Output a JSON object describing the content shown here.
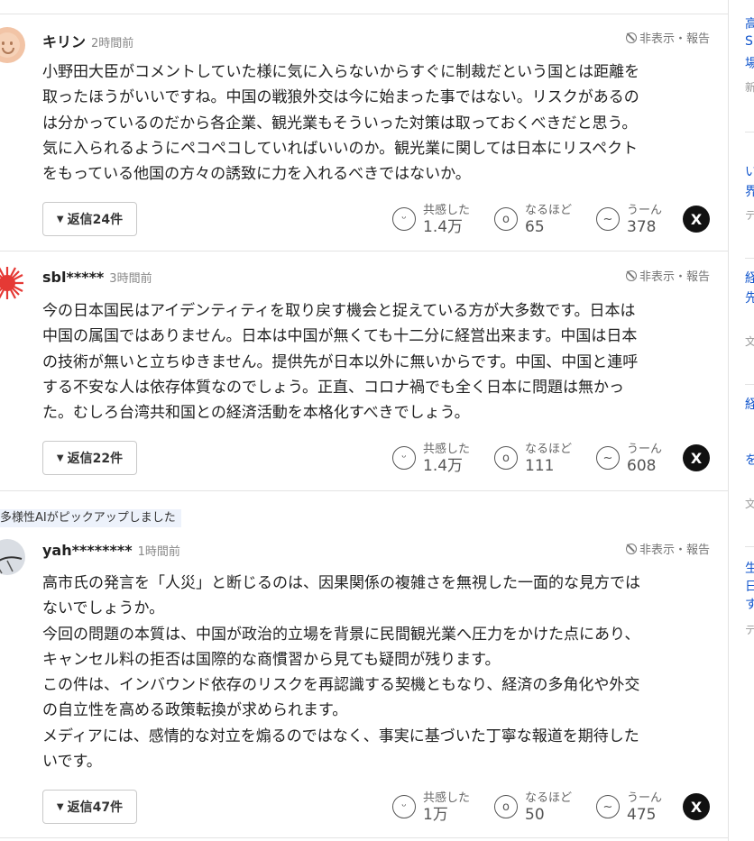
{
  "comments": [
    {
      "user": "キリン",
      "time": "2時間前",
      "hide_report": "非表示・報告",
      "lines": [
        "小野田大臣がコメントしていた様に気に入らないからすぐに制裁だという国とは距離を",
        "取ったほうがいいですね。中国の戦狼外交は今に始まった事ではない。リスクがあるの",
        "は分かっているのだから各企業、観光業もそういった対策は取っておくべきだと思う。",
        "気に入られるようにペコペコしていればいいのか。観光業に関しては日本にリスペクト",
        "をもっている他国の方々の誘致に力を入れるべきではないか。"
      ],
      "reply_label": "返信24件",
      "reactions": [
        {
          "label": "共感した",
          "count": "1.4万"
        },
        {
          "label": "なるほど",
          "count": "65"
        },
        {
          "label": "うーん",
          "count": "378"
        }
      ]
    },
    {
      "user": "sbl*****",
      "time": "3時間前",
      "hide_report": "非表示・報告",
      "lines": [
        "今の日本国民はアイデンティティを取り戻す機会と捉えている方が大多数です。日本は",
        "中国の属国ではありません。日本は中国が無くても十二分に経営出来ます。中国は日本",
        "の技術が無いと立ちゆきません。提供先が日本以外に無いからです。中国、中国と連呼",
        "する不安な人は依存体質なのでしょう。正直、コロナ禍でも全く日本に問題は無かっ",
        "た。むしろ台湾共和国との経済活動を本格化すべきでしょう。"
      ],
      "reply_label": "返信22件",
      "reactions": [
        {
          "label": "共感した",
          "count": "1.4万"
        },
        {
          "label": "なるほど",
          "count": "111"
        },
        {
          "label": "うーん",
          "count": "608"
        }
      ]
    },
    {
      "ai_tag": "多様性AIがピックアップしました",
      "user": "yah********",
      "time": "1時間前",
      "hide_report": "非表示・報告",
      "lines": [
        "高市氏の発言を「人災」と断じるのは、因果関係の複雑さを無視した一面的な見方では",
        "ないでしょうか。",
        "今回の問題の本質は、中国が政治的立場を背景に民間観光業へ圧力をかけた点にあり、",
        "キャンセル料の拒否は国際的な商慣習から見ても疑問が残ります。",
        "この件は、インバウンド依存のリスクを再認識する契機ともなり、経済の多角化や外交",
        "の自立性を高める政策転換が求められます。",
        "メディアには、感情的な対立を煽るのではなく、事実に基づいた丁寧な報道を期待した",
        "いです。"
      ],
      "reply_label": "返信47件",
      "reactions": [
        {
          "label": "共感した",
          "count": "1万"
        },
        {
          "label": "なるほど",
          "count": "50"
        },
        {
          "label": "うーん",
          "count": "475"
        }
      ]
    }
  ],
  "share": {
    "x_label": "X"
  },
  "sidebar": {
    "fragments": [
      "高",
      "S",
      "場",
      "新",
      "い",
      "界",
      "テ",
      "経",
      "先",
      "文",
      "経",
      "を",
      "文",
      "生",
      "日",
      "す",
      "テ"
    ]
  },
  "colors": {
    "link_blue": "#1155cc",
    "ai_tag_bg": "#edf2fb",
    "border": "#e3e3e3"
  }
}
